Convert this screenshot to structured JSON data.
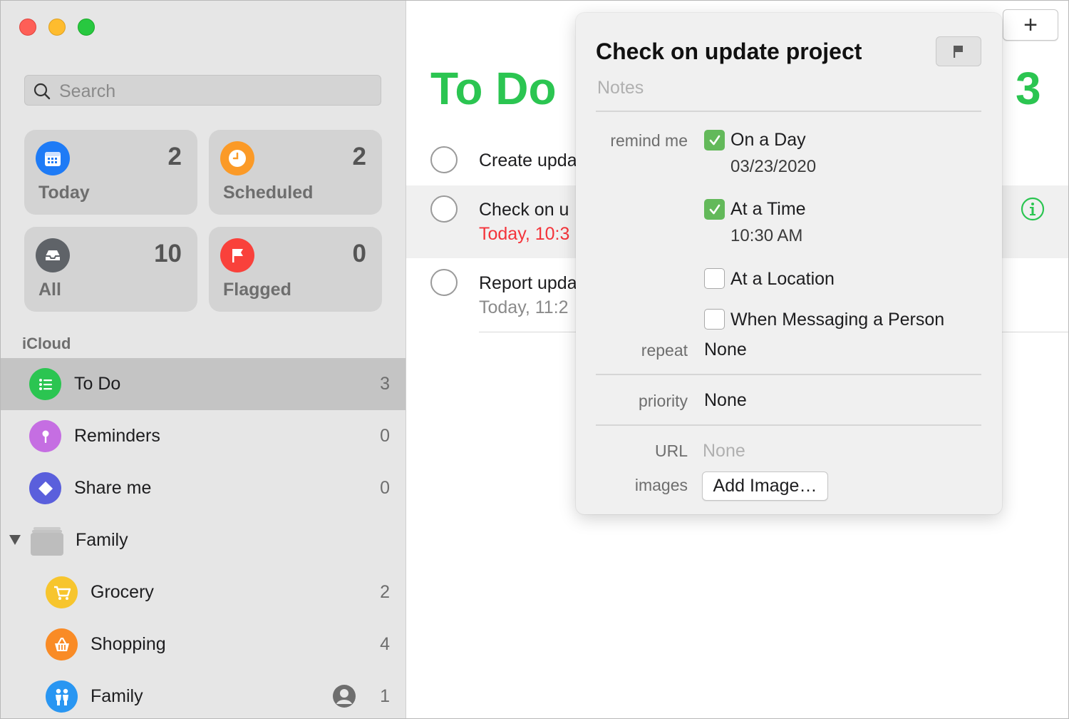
{
  "sidebar": {
    "search_placeholder": "Search",
    "smart_lists": [
      {
        "label": "Today",
        "count": "2",
        "icon": "calendar-icon",
        "color": "#1e7bf6"
      },
      {
        "label": "Scheduled",
        "count": "2",
        "icon": "clock-icon",
        "color": "#fb9a27"
      },
      {
        "label": "All",
        "count": "10",
        "icon": "tray-icon",
        "color": "#5f6368"
      },
      {
        "label": "Flagged",
        "count": "0",
        "icon": "flag-icon",
        "color": "#f9413b"
      }
    ],
    "section_label": "iCloud",
    "lists": [
      {
        "name": "To Do",
        "count": "3",
        "icon": "list-bullet-icon",
        "color": "#2bc551"
      },
      {
        "name": "Reminders",
        "count": "0",
        "icon": "pin-icon",
        "color": "#c56ee2"
      },
      {
        "name": "Share me",
        "count": "0",
        "icon": "diamond-icon",
        "color": "#5a5fdc"
      },
      {
        "name": "Family",
        "count": "",
        "icon": "folder-icon",
        "color": "#bdbdbd"
      },
      {
        "name": "Grocery",
        "count": "2",
        "icon": "cart-icon",
        "color": "#f7c52d"
      },
      {
        "name": "Shopping",
        "count": "4",
        "icon": "basket-icon",
        "color": "#f98b26"
      },
      {
        "name": "Family",
        "count": "1",
        "icon": "people-icon",
        "color": "#2996f2"
      }
    ]
  },
  "main": {
    "title": "To Do",
    "count": "3",
    "add_label": "+",
    "tasks": [
      {
        "title": "Create upda",
        "subtitle": ""
      },
      {
        "title": "Check on u",
        "subtitle": "Today, 10:3"
      },
      {
        "title": "Report upda",
        "subtitle": "Today, 11:2"
      }
    ],
    "accent_color": "#2bc551",
    "overdue_color": "#f4333a"
  },
  "popover": {
    "title": "Check on update project",
    "notes_placeholder": "Notes",
    "remind_me_label": "remind me",
    "on_a_day_label": "On a Day",
    "date_value": "03/23/2020",
    "at_a_time_label": "At a Time",
    "time_value": "10:30 AM",
    "at_location_label": "At a Location",
    "messaging_label": "When Messaging a Person",
    "repeat_label": "repeat",
    "repeat_value": "None",
    "priority_label": "priority",
    "priority_value": "None",
    "url_label": "URL",
    "url_value": "None",
    "images_label": "images",
    "add_image_label": "Add Image…"
  }
}
